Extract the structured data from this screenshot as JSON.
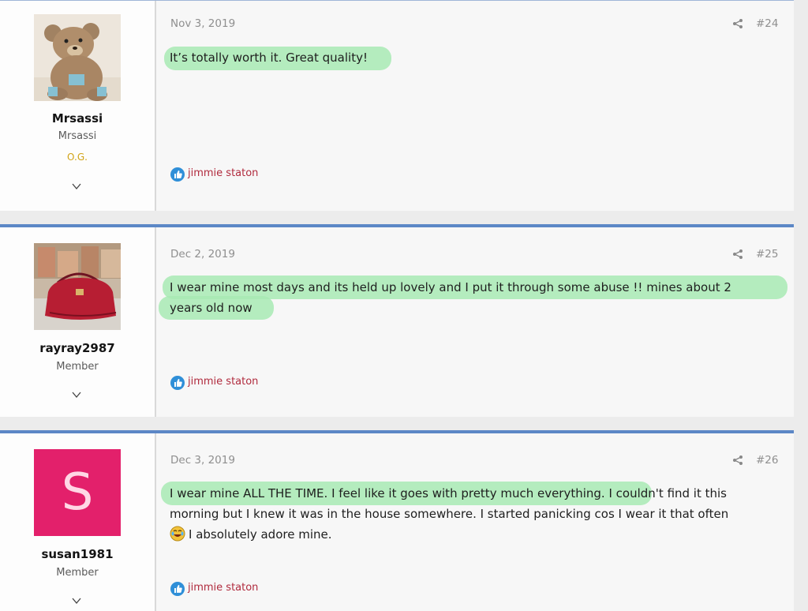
{
  "posts": [
    {
      "user": {
        "name": "Mrsassi",
        "title": "Mrsassi",
        "banner": "O.G."
      },
      "date": "Nov 3, 2019",
      "number": "#24",
      "body_lines": [
        "It’s totally worth it. Great quality!"
      ],
      "reaction_user": "jimmie staton"
    },
    {
      "user": {
        "name": "rayray2987",
        "title": "Member"
      },
      "date": "Dec 2, 2019",
      "number": "#25",
      "body_lines": [
        "I wear mine most days and its held up lovely and I put it through some abuse !! mines about 2",
        "years old now"
      ],
      "reaction_user": "jimmie staton"
    },
    {
      "user": {
        "name": "susan1981",
        "title": "Member",
        "avatar_letter": "S"
      },
      "date": "Dec 3, 2019",
      "number": "#26",
      "body_lines": [
        "I wear mine ALL THE TIME. I feel like it goes with pretty much everything. I couldn't find it this",
        "morning but I knew it was in the house somewhere. I started panicking cos I wear it that often",
        "I absolutely adore mine."
      ],
      "reaction_user": "jimmie staton"
    }
  ],
  "icons": {
    "expand": "chevron-down-icon",
    "share": "share-icon",
    "like": "thumbs-up-icon",
    "emoji": "crying-laughing-emoji-icon"
  },
  "colors": {
    "accent_border": "#5c87c6",
    "highlight": "#a8eab4",
    "reaction_name": "#b02a3d",
    "banner": "#d1a316",
    "avatar_s": "#e3206b"
  }
}
